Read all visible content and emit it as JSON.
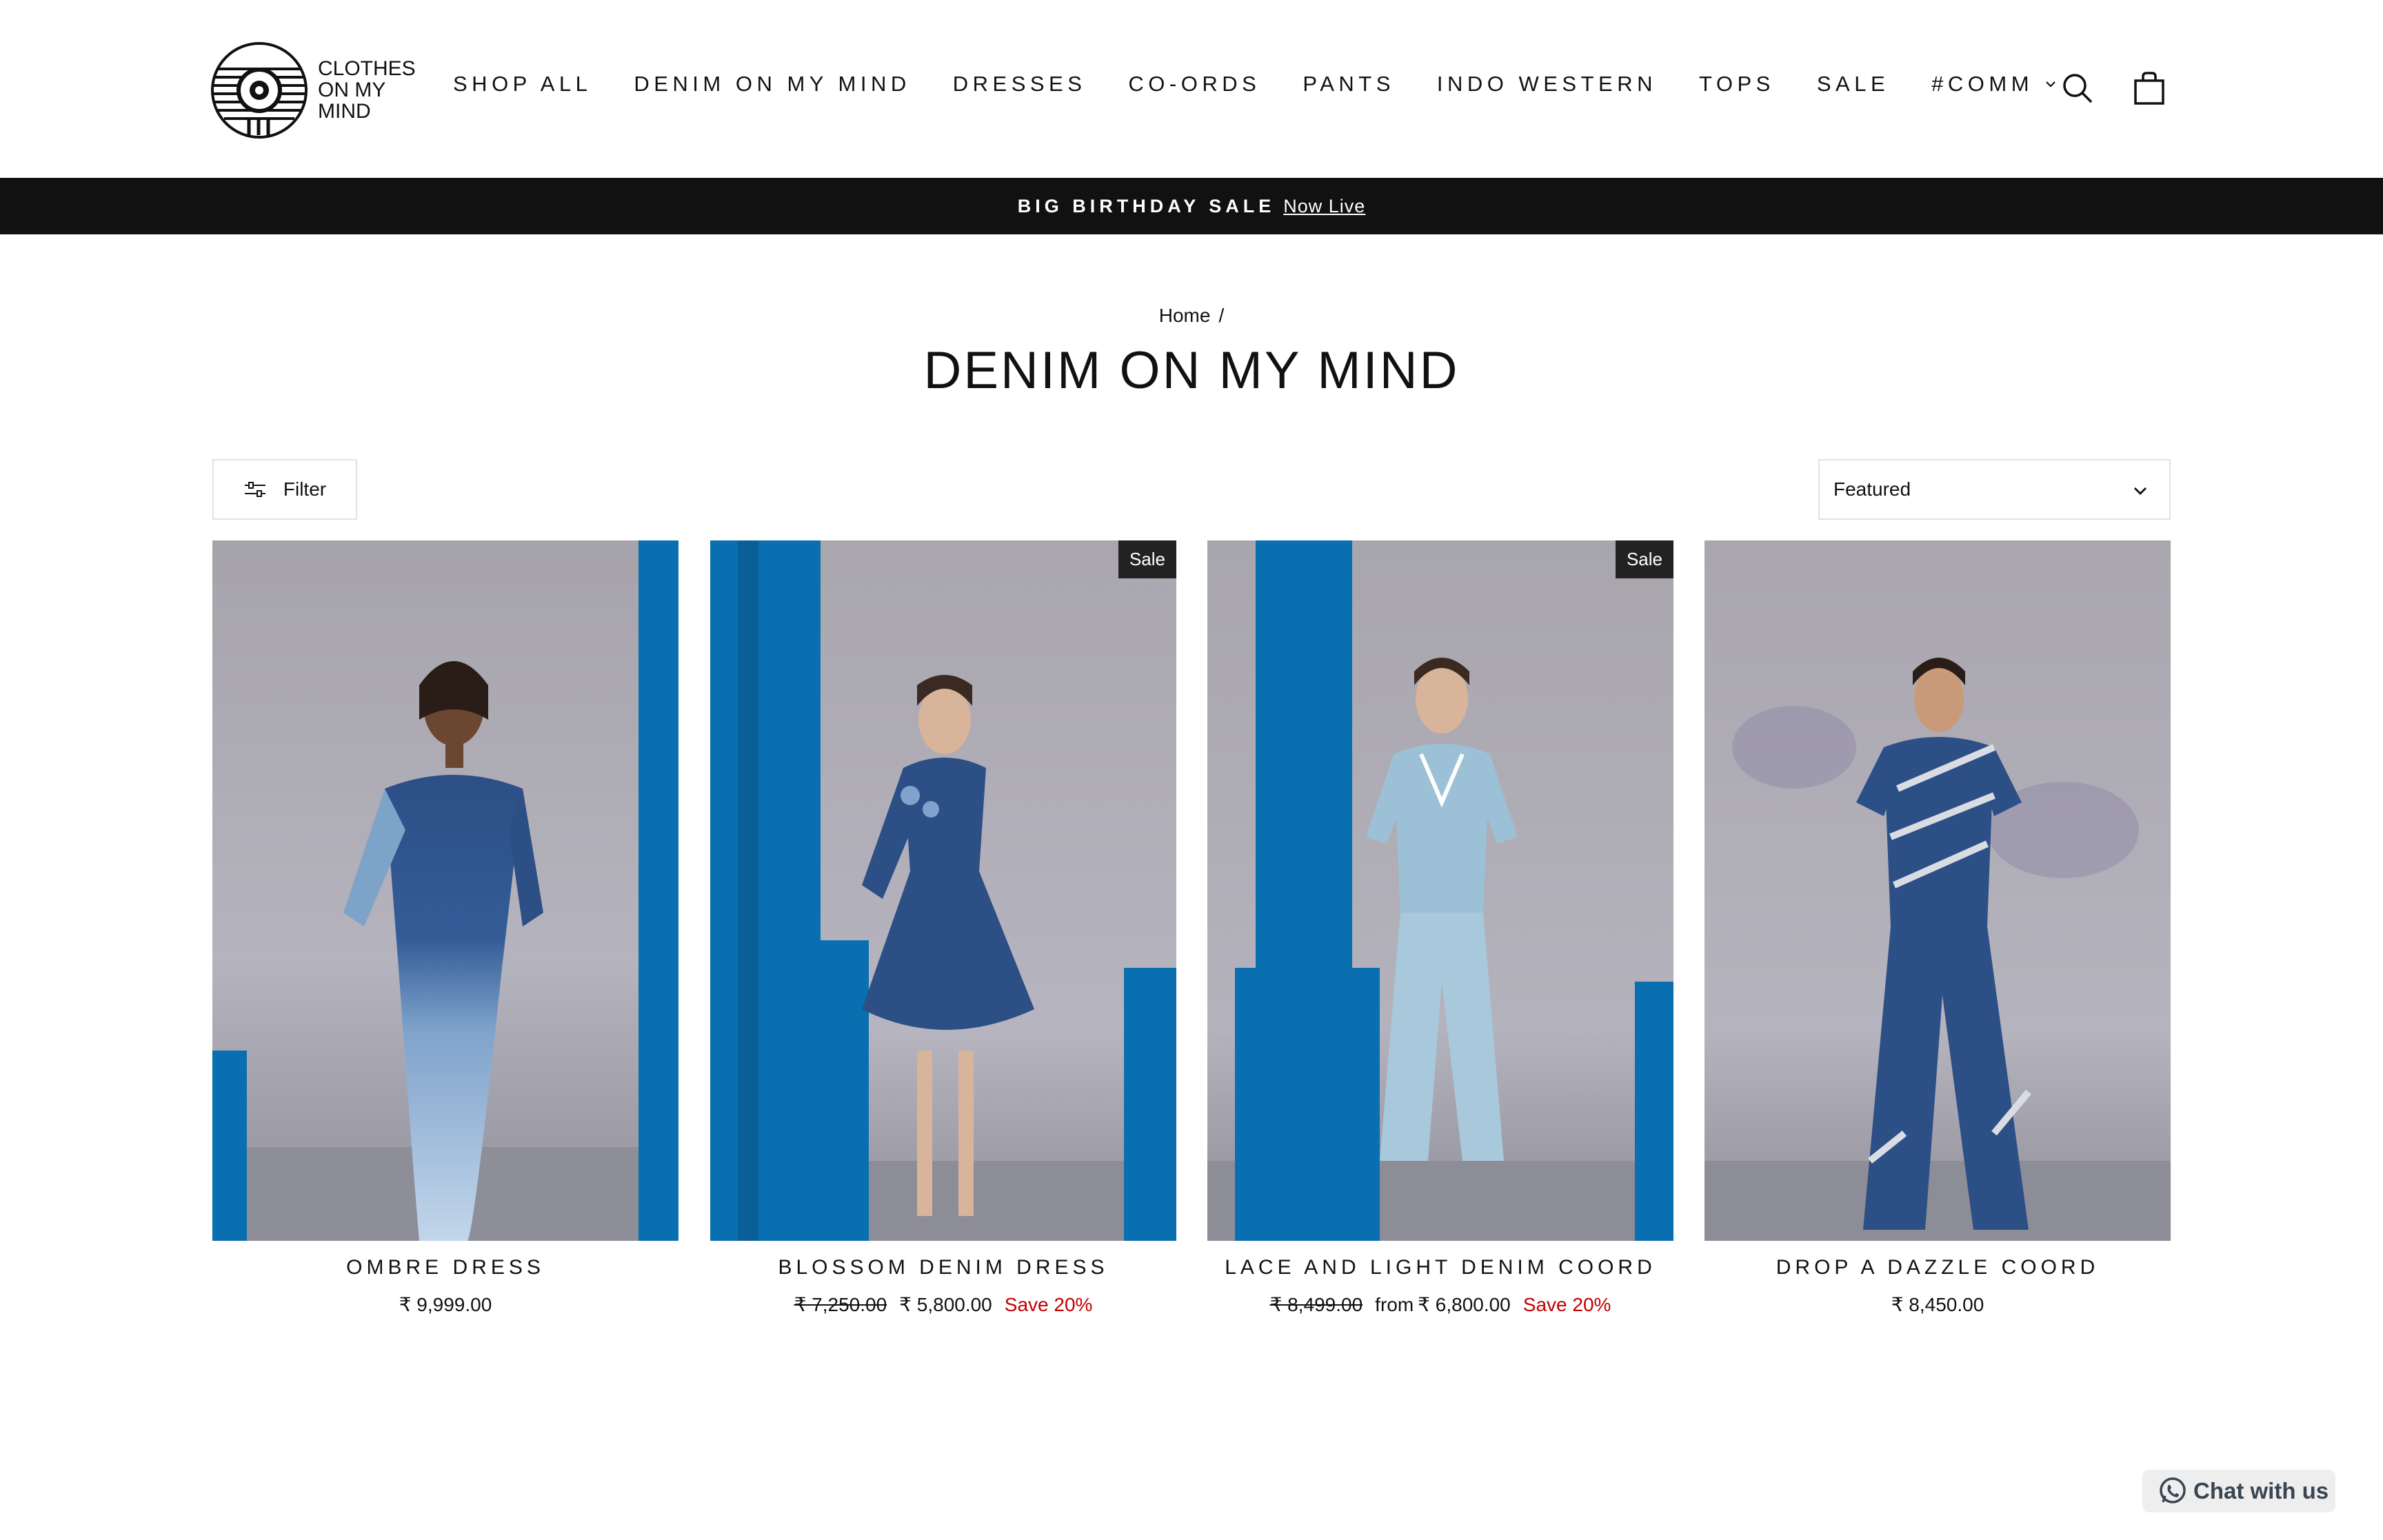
{
  "brand": {
    "logo_text_line1": "CLOTHES",
    "logo_text_line2": "ON MY",
    "logo_text_line3": "MIND",
    "logo_icon": "comm-logo-icon"
  },
  "nav": {
    "items": [
      {
        "label": "SHOP ALL"
      },
      {
        "label": "DENIM ON MY MIND"
      },
      {
        "label": "DRESSES"
      },
      {
        "label": "CO-ORDS"
      },
      {
        "label": "PANTS"
      },
      {
        "label": "INDO WESTERN"
      },
      {
        "label": "TOPS"
      },
      {
        "label": "SALE"
      },
      {
        "label": "#COMM",
        "icon": "chevron-down-icon"
      }
    ],
    "search_icon": "search-icon",
    "cart_icon": "cart-icon"
  },
  "announcement": {
    "bold": "BIG BIRTHDAY SALE",
    "link": "Now Live"
  },
  "breadcrumb": {
    "home": "Home",
    "separator": "/"
  },
  "page": {
    "title": "DENIM ON MY MIND"
  },
  "toolbar": {
    "filter_label": "Filter",
    "filter_icon": "sliders-icon",
    "sort_selected": "Featured",
    "sort_icon": "chevron-down-icon"
  },
  "products": [
    {
      "name": "OMBRE DRESS",
      "price": "₹ 9,999.00",
      "sale_badge": ""
    },
    {
      "name": "BLOSSOM DENIM DRESS",
      "was": "₹ 7,250.00",
      "price": "₹ 5,800.00",
      "save": "Save 20%",
      "sale_badge": "Sale"
    },
    {
      "name": "LACE AND LIGHT DENIM COORD",
      "was": "₹ 8,499.00",
      "from": "from",
      "price": "₹ 6,800.00",
      "save": "Save 20%",
      "sale_badge": "Sale"
    },
    {
      "name": "DROP A DAZZLE COORD",
      "price": "₹ 8,450.00",
      "sale_badge": ""
    }
  ],
  "chat": {
    "label": "Chat with us",
    "icon": "whatsapp-icon"
  },
  "colors": {
    "announcement_bg": "#111111",
    "save_red": "#c20000",
    "badge_bg": "#222222",
    "pillar_blue": "#0a6fb0"
  }
}
